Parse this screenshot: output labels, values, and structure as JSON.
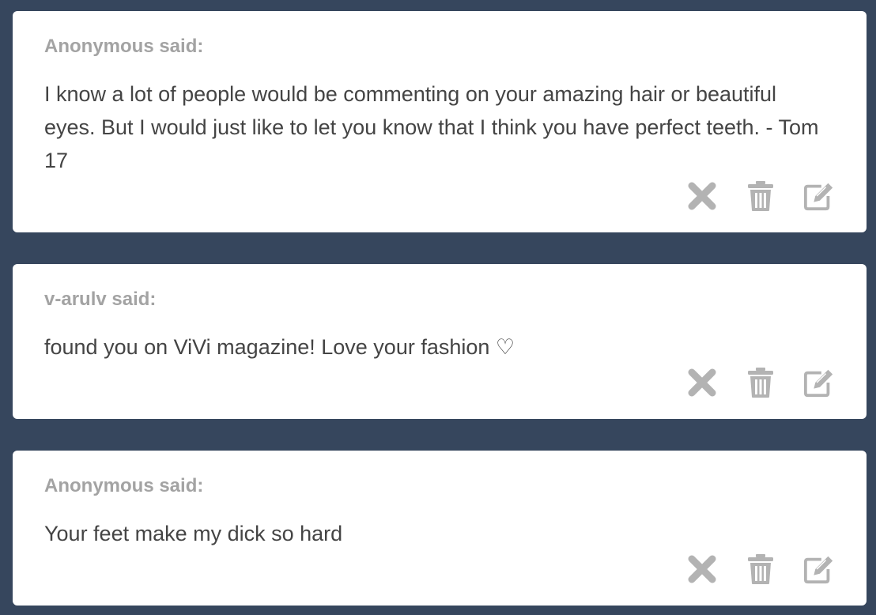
{
  "colors": {
    "background": "#36465d",
    "card": "#ffffff",
    "asker_text": "#a3a3a3",
    "question_text": "#444444",
    "icon": "#b3b3b3"
  },
  "messages": [
    {
      "asker": "Anonymous said:",
      "text": "I know a lot of people would be commenting on your amazing hair or beautiful eyes. But I would just like to let you know that I think you have perfect teeth. - Tom 17",
      "actions": [
        "close-icon",
        "trash-icon",
        "edit-icon"
      ]
    },
    {
      "asker": "v-arulv said:",
      "text": "found you on ViVi magazine! Love your fashion ♡",
      "actions": [
        "close-icon",
        "trash-icon",
        "edit-icon"
      ]
    },
    {
      "asker": "Anonymous said:",
      "text": "Your feet make my dick so hard",
      "actions": [
        "close-icon",
        "trash-icon",
        "edit-icon"
      ]
    }
  ]
}
